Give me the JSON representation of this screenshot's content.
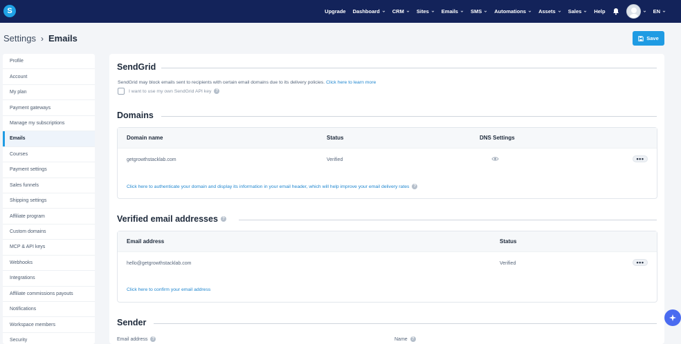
{
  "app": {
    "logo_letter": "S"
  },
  "nav": {
    "items": [
      {
        "label": "Upgrade",
        "dropdown": false
      },
      {
        "label": "Dashboard",
        "dropdown": true
      },
      {
        "label": "CRM",
        "dropdown": true
      },
      {
        "label": "Sites",
        "dropdown": true
      },
      {
        "label": "Emails",
        "dropdown": true
      },
      {
        "label": "SMS",
        "dropdown": true
      },
      {
        "label": "Automations",
        "dropdown": true
      },
      {
        "label": "Assets",
        "dropdown": true
      },
      {
        "label": "Sales",
        "dropdown": true
      },
      {
        "label": "Help",
        "dropdown": false
      }
    ],
    "language": "EN"
  },
  "breadcrumb": {
    "parent": "Settings",
    "current": "Emails"
  },
  "save_label": "Save",
  "sidebar": {
    "items": [
      "Profile",
      "Account",
      "My plan",
      "Payment gateways",
      "Manage my subscriptions",
      "Emails",
      "Courses",
      "Payment settings",
      "Sales funnels",
      "Shipping settings",
      "Affiliate program",
      "Custom domains",
      "MCP & API keys",
      "Webhooks",
      "Integrations",
      "Affiliate commissions payouts",
      "Notifications",
      "Workspace members",
      "Security"
    ],
    "active": "Emails"
  },
  "sendgrid": {
    "title": "SendGrid",
    "description": "SendGrid may block emails sent to recipients with certain email domains due to its delivery policies.",
    "learn_more": "Click here to learn more",
    "checkbox_label": "I want to use my own SendGrid API key"
  },
  "domains": {
    "title": "Domains",
    "columns": [
      "Domain name",
      "Status",
      "DNS Settings"
    ],
    "rows": [
      {
        "domain": "getgrowthstacklab.com",
        "status": "Verified"
      }
    ],
    "more": "•••",
    "auth_link": "Click here to authenticate your domain and display its information in your email header, which will help improve your email delivery rates"
  },
  "verified_emails": {
    "title": "Verified email addresses",
    "columns": [
      "Email address",
      "Status"
    ],
    "rows": [
      {
        "email": "hello@getgrowthstacklab.com",
        "status": "Verified"
      }
    ],
    "more": "•••",
    "confirm_link": "Click here to confirm your email address"
  },
  "sender": {
    "title": "Sender",
    "email_label": "Email address",
    "name_label": "Name"
  },
  "colors": {
    "topbar": "#13235a",
    "accent": "#1f9be3",
    "fab": "#4a6bf0"
  }
}
